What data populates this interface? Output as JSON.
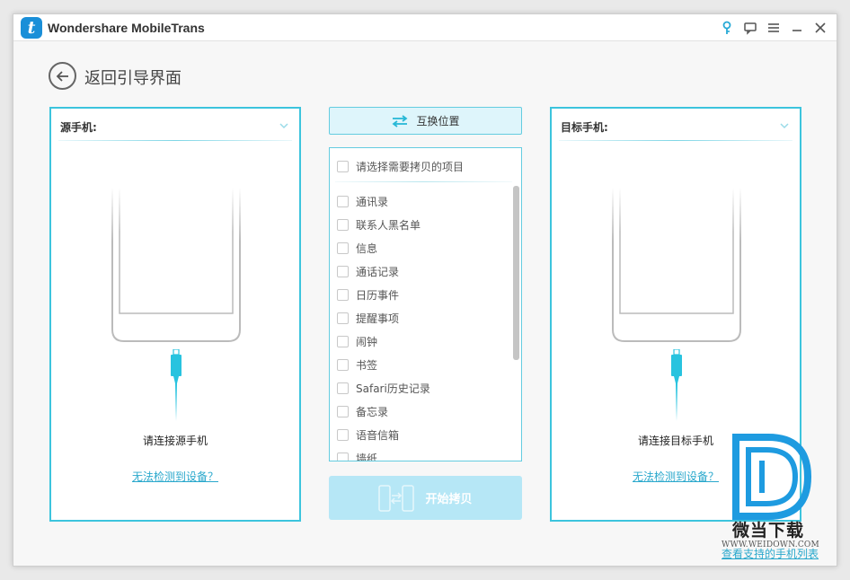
{
  "window": {
    "title": "Wondershare MobileTrans",
    "logo_letter": "t"
  },
  "titlebar_icons": [
    "key-icon",
    "feedback-icon",
    "menu-icon",
    "minimize-icon",
    "close-icon"
  ],
  "nav": {
    "back_label": "返回引导界面"
  },
  "source_panel": {
    "title": "源手机:",
    "status": "请连接源手机",
    "help_link": "无法检测到设备？"
  },
  "target_panel": {
    "title": "目标手机:",
    "status": "请连接目标手机",
    "help_link": "无法检测到设备？"
  },
  "swap_button": {
    "label": "互换位置"
  },
  "content_list": {
    "header": "请选择需要拷贝的项目",
    "items": [
      {
        "label": "通讯录",
        "checked": false
      },
      {
        "label": "联系人黑名单",
        "checked": false
      },
      {
        "label": "信息",
        "checked": false
      },
      {
        "label": "通话记录",
        "checked": false
      },
      {
        "label": "日历事件",
        "checked": false
      },
      {
        "label": "提醒事项",
        "checked": false
      },
      {
        "label": "闹钟",
        "checked": false
      },
      {
        "label": "书签",
        "checked": false
      },
      {
        "label": "Safari历史记录",
        "checked": false
      },
      {
        "label": "备忘录",
        "checked": false
      },
      {
        "label": "语音信箱",
        "checked": false
      },
      {
        "label": "墙纸",
        "checked": false
      }
    ]
  },
  "start_button": {
    "label": "开始拷贝",
    "enabled": false
  },
  "bottom_link": "查看支持的手机列表",
  "watermark": {
    "name": "微当下载",
    "url": "WWW.WEIDOWN.COM"
  },
  "colors": {
    "accent": "#3cc4dd",
    "link": "#2aa8cc",
    "cable": "#28c3df",
    "start_disabled": "#b6e7f6",
    "swap_bg": "#def5fb"
  }
}
